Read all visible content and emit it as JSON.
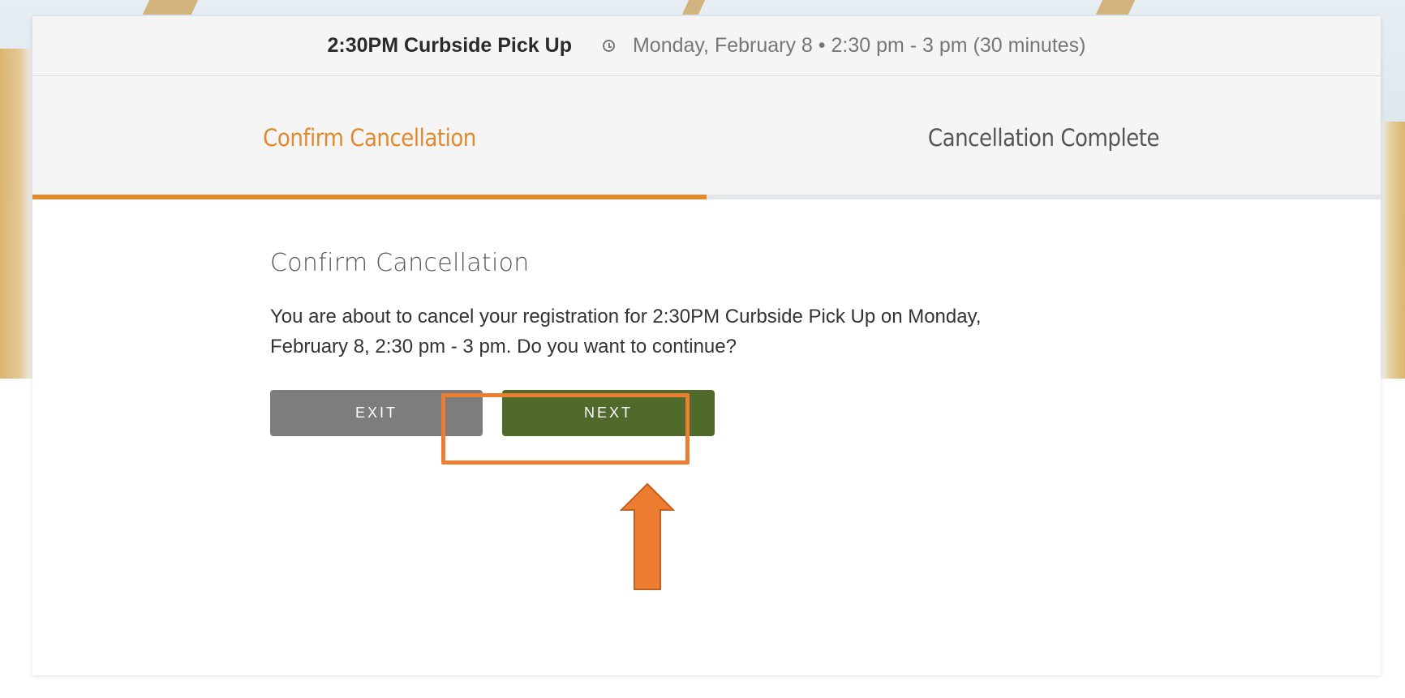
{
  "event": {
    "name": "2:30PM Curbside Pick Up",
    "time": "Monday, February 8 • 2:30 pm - 3 pm (30 minutes)",
    "icon": "clock-icon"
  },
  "steps": [
    {
      "label": "Confirm Cancellation",
      "state": "active"
    },
    {
      "label": "Cancellation Complete",
      "state": "inactive"
    }
  ],
  "main": {
    "heading": "Confirm Cancellation",
    "message": "You are about to cancel your registration for 2:30PM Curbside Pick Up on Monday, February 8, 2:30 pm - 3 pm. Do you want to continue?",
    "exit_label": "EXIT",
    "next_label": "NEXT"
  },
  "colors": {
    "accent": "#e0892d",
    "next_button": "#4f6a2b",
    "exit_button": "#7d7d7d",
    "annotation": "#ec7d31"
  }
}
